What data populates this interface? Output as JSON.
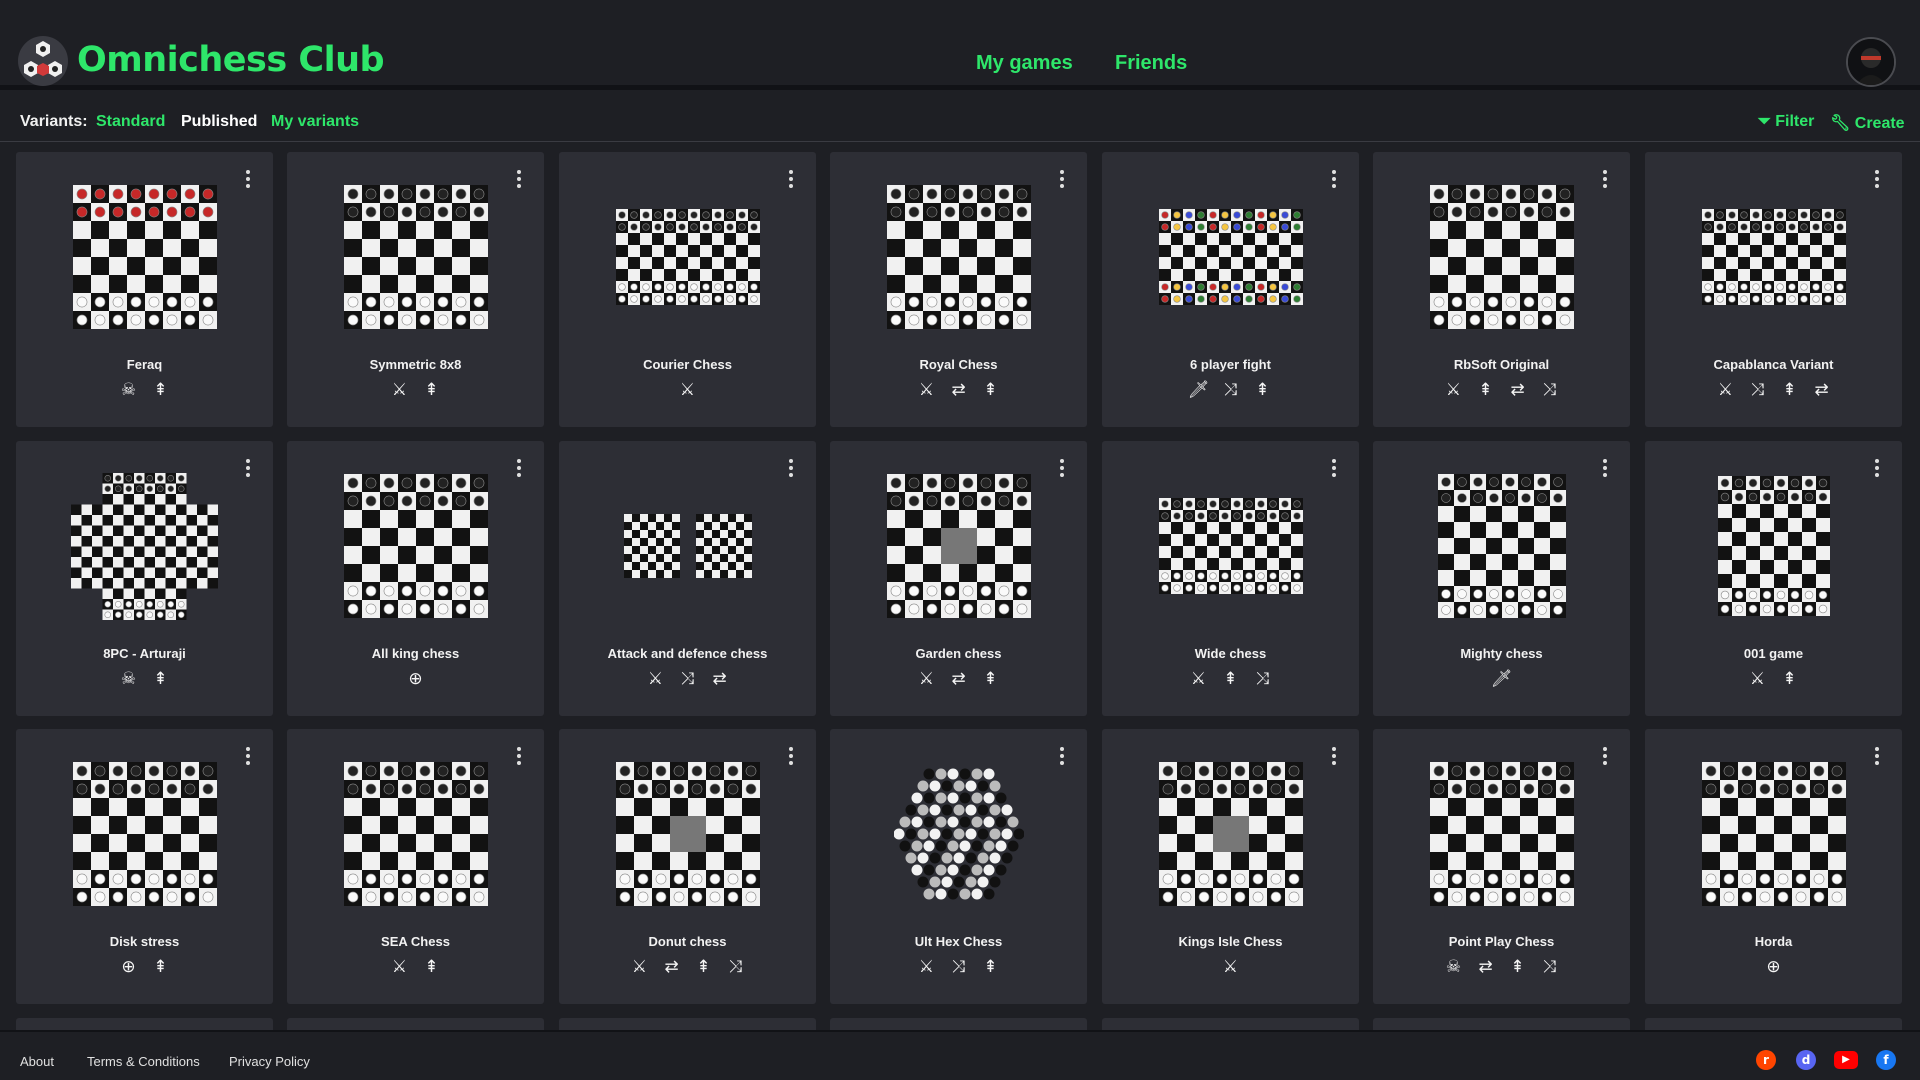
{
  "app": {
    "brand": "Omnichess Club",
    "nav": {
      "my_games": "My games",
      "friends": "Friends"
    }
  },
  "subbar": {
    "label": "Variants:",
    "standard": "Standard",
    "published": "Published",
    "my_variants": "My variants",
    "filter": "Filter",
    "create": "Create"
  },
  "variants": [
    {
      "name": "Feraq",
      "board": "std-red",
      "icons": [
        "skull",
        "stack"
      ]
    },
    {
      "name": "Symmetric 8x8",
      "board": "std",
      "icons": [
        "swords",
        "stack"
      ]
    },
    {
      "name": "Courier Chess",
      "board": "wide",
      "icons": [
        "swords"
      ]
    },
    {
      "name": "Royal Chess",
      "board": "std",
      "icons": [
        "swords",
        "swap",
        "stack"
      ]
    },
    {
      "name": "6 player fight",
      "board": "wide-color",
      "icons": [
        "sword",
        "random",
        "stack"
      ]
    },
    {
      "name": "RbSoft Original",
      "board": "std",
      "icons": [
        "swords",
        "stack",
        "swap",
        "random"
      ]
    },
    {
      "name": "Capablanca Variant",
      "board": "wide",
      "icons": [
        "swords",
        "random",
        "stack",
        "swap"
      ]
    },
    {
      "name": "8PC - Arturaji",
      "board": "cross",
      "icons": [
        "skull",
        "stack"
      ]
    },
    {
      "name": "All king chess",
      "board": "std",
      "icons": [
        "target"
      ]
    },
    {
      "name": "Attack and defence chess",
      "board": "double",
      "icons": [
        "swords",
        "random",
        "swap"
      ]
    },
    {
      "name": "Garden chess",
      "board": "std-gray",
      "icons": [
        "swords",
        "swap",
        "stack"
      ]
    },
    {
      "name": "Wide chess",
      "board": "wide",
      "icons": [
        "swords",
        "stack",
        "random"
      ]
    },
    {
      "name": "Mighty chess",
      "board": "narrow",
      "icons": [
        "sword"
      ]
    },
    {
      "name": "001 game",
      "board": "narrow2",
      "icons": [
        "swords",
        "stack"
      ]
    },
    {
      "name": "Disk stress",
      "board": "std",
      "icons": [
        "target",
        "stack"
      ]
    },
    {
      "name": "SEA Chess",
      "board": "std",
      "icons": [
        "swords",
        "stack"
      ]
    },
    {
      "name": "Donut chess",
      "board": "std-gray",
      "icons": [
        "swords",
        "swap",
        "stack",
        "random"
      ]
    },
    {
      "name": "Ult Hex Chess",
      "board": "hex",
      "icons": [
        "swords",
        "random",
        "stack"
      ]
    },
    {
      "name": "Kings Isle Chess",
      "board": "std-gray",
      "icons": [
        "swords"
      ]
    },
    {
      "name": "Point Play Chess",
      "board": "std",
      "icons": [
        "skull",
        "swap",
        "stack",
        "random"
      ]
    },
    {
      "name": "Horda",
      "board": "std",
      "icons": [
        "target"
      ]
    }
  ],
  "footer": {
    "about": "About",
    "terms": "Terms & Conditions",
    "privacy": "Privacy Policy"
  },
  "social": [
    "reddit-icon",
    "discord-icon",
    "youtube-icon",
    "facebook-icon"
  ],
  "colors": {
    "accent": "#2ee66a",
    "bg": "#1e1f24",
    "card": "#2d2e35"
  }
}
